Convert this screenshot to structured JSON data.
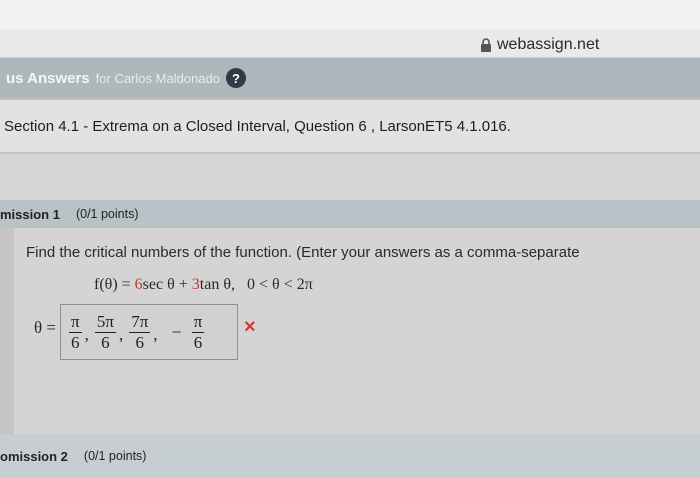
{
  "browser": {
    "url": "webassign.net"
  },
  "answers_bar": {
    "title": "us Answers",
    "for_text": "for Carlos Maldonado",
    "help_label": "?"
  },
  "section": {
    "title": "Section 4.1 - Extrema on a Closed Interval, Question 6 , LarsonET5 4.1.016."
  },
  "submission1": {
    "label": "mission 1",
    "points": "(0/1 points)"
  },
  "question": {
    "prompt": "Find the critical numbers of the function. (Enter your answers as a comma-separate",
    "function_lhs": "f(θ) = ",
    "coef1": "6",
    "term1": "sec θ + ",
    "coef2": "3",
    "term2": "tan θ,",
    "interval": "0 < θ < 2π",
    "theta_label": "θ =",
    "answer": [
      {
        "num": "π",
        "den": "6"
      },
      {
        "num": "5π",
        "den": "6"
      },
      {
        "num": "7π",
        "den": "6"
      }
    ],
    "answer_sep": ",",
    "answer_minus": "−",
    "answer_last": {
      "num": "π",
      "den": "6"
    },
    "status_icon": "×"
  },
  "submission2": {
    "label": "omission 2",
    "points": "(0/1 points)"
  }
}
